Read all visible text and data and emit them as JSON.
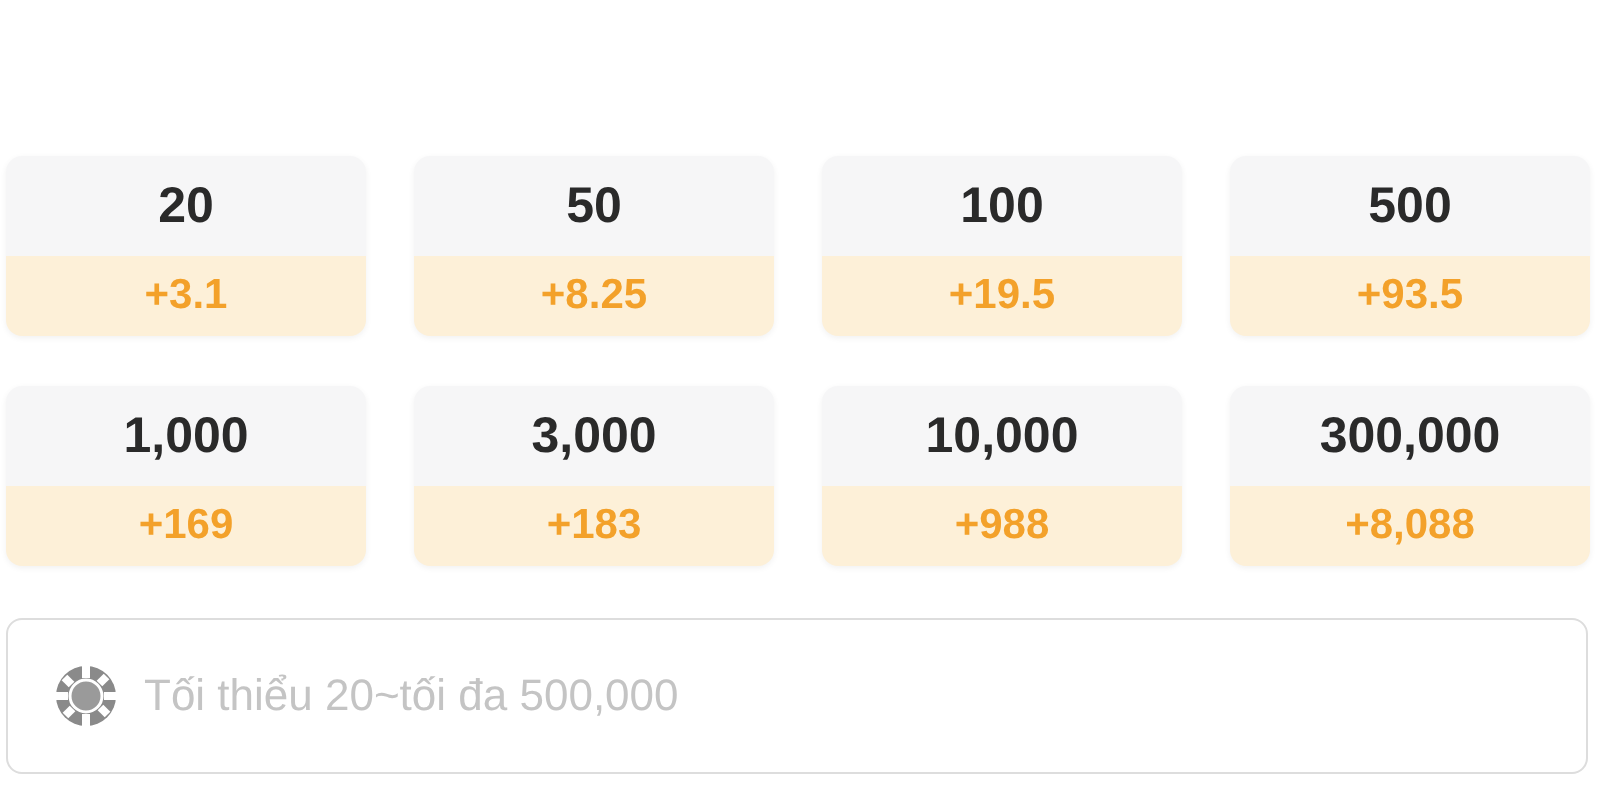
{
  "options": [
    {
      "amount": "20",
      "bonus": "+3.1"
    },
    {
      "amount": "50",
      "bonus": "+8.25"
    },
    {
      "amount": "100",
      "bonus": "+19.5"
    },
    {
      "amount": "500",
      "bonus": "+93.5"
    },
    {
      "amount": "1,000",
      "bonus": "+169"
    },
    {
      "amount": "3,000",
      "bonus": "+183"
    },
    {
      "amount": "10,000",
      "bonus": "+988"
    },
    {
      "amount": "300,000",
      "bonus": "+8,088"
    }
  ],
  "amount_field": {
    "placeholder": "Tối thiểu 20~tối đa 500,000"
  }
}
